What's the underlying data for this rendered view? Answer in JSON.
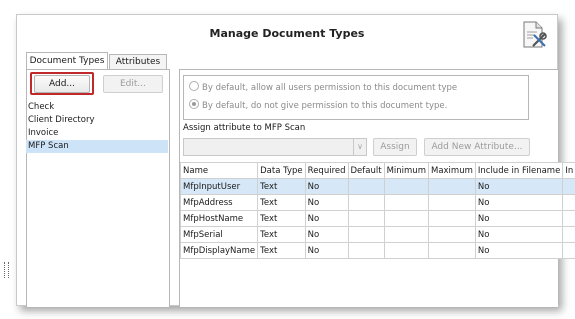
{
  "dialog": {
    "title": "Manage Document Types",
    "icon": "document-settings-icon"
  },
  "tabs": [
    {
      "label": "Document Types"
    },
    {
      "label": "Attributes"
    }
  ],
  "left": {
    "add_label": "Add...",
    "edit_label": "Edit...",
    "document_types": [
      "Check",
      "Client Directory",
      "Invoice",
      "MFP Scan"
    ],
    "selected": "MFP Scan"
  },
  "permissions": {
    "option_allow": "By default, allow all users permission to this document type",
    "option_deny": "By default, do not give permission to this document type.",
    "selected": "option_deny"
  },
  "assign": {
    "label": "Assign attribute to MFP Scan",
    "combo_value": "",
    "assign_label": "Assign",
    "add_new_label": "Add New Attribute..."
  },
  "grid": {
    "columns": [
      "Name",
      "Data Type",
      "Required",
      "Default",
      "Minimum",
      "Maximum",
      "Include in Filename",
      "In"
    ],
    "rows": [
      [
        "MfpInputUser",
        "Text",
        "No",
        "",
        "",
        "",
        "No",
        ""
      ],
      [
        "MfpAddress",
        "Text",
        "No",
        "",
        "",
        "",
        "No",
        ""
      ],
      [
        "MfpHostName",
        "Text",
        "No",
        "",
        "",
        "",
        "No",
        ""
      ],
      [
        "MfpSerial",
        "Text",
        "No",
        "",
        "",
        "",
        "No",
        ""
      ],
      [
        "MfpDisplayName",
        "Text",
        "No",
        "",
        "",
        "",
        "No",
        ""
      ]
    ],
    "selected_row": 0
  },
  "colors": {
    "highlight_border": "#c0282b",
    "selection": "#cde3f7"
  }
}
